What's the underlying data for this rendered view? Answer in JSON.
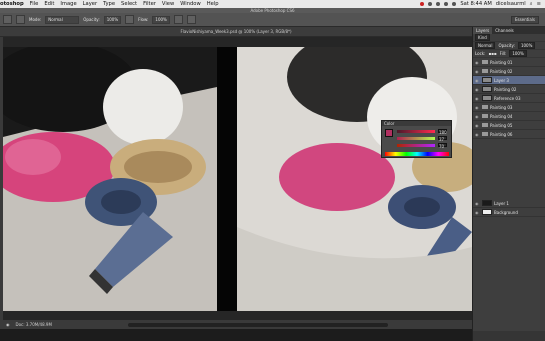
{
  "menubar": {
    "app": "otoshop",
    "items": [
      "File",
      "Edit",
      "Image",
      "Layer",
      "Type",
      "Select",
      "Filter",
      "View",
      "Window",
      "Help"
    ],
    "clock": "Sat 8:44 AM",
    "user": "dicelsaurml"
  },
  "window": {
    "title": "Adobe Photoshop CS6"
  },
  "options": {
    "mode_label": "Mode:",
    "mode_value": "Normal",
    "opacity_label": "Opacity:",
    "opacity_value": "100%",
    "flow_label": "Flow:",
    "flow_value": "100%",
    "workspace": "Essentials"
  },
  "document": {
    "tab": "FlavioNishiyama_Week3.psd @ 100% (Layer 3, RGB/8*)"
  },
  "status": {
    "doc": "Doc: 3.70M/48.9M"
  },
  "panel": {
    "tabs": [
      "Layers",
      "Channels"
    ],
    "kind": "Kind",
    "blend": "Normal",
    "opacity_label": "Opacity:",
    "opacity_value": "100%",
    "lock_label": "Lock:",
    "fill_label": "Fill:",
    "fill_value": "100%",
    "layers": [
      {
        "name": "Painting 01",
        "type": "folder"
      },
      {
        "name": "Painting 02",
        "type": "folder"
      },
      {
        "name": "Layer 3",
        "type": "layer",
        "selected": true
      },
      {
        "name": "Painting 02",
        "type": "layer"
      },
      {
        "name": "Reference 03",
        "type": "layer"
      },
      {
        "name": "Painting 03",
        "type": "folder"
      },
      {
        "name": "Painting 04",
        "type": "folder"
      },
      {
        "name": "Painting 05",
        "type": "folder"
      },
      {
        "name": "Painting 06",
        "type": "folder"
      },
      {
        "name": "Layer 1",
        "type": "layer"
      },
      {
        "name": "Background",
        "type": "layer"
      }
    ]
  },
  "color_panel": {
    "title": "Color",
    "r": "180",
    "g": "37",
    "b": "70"
  }
}
